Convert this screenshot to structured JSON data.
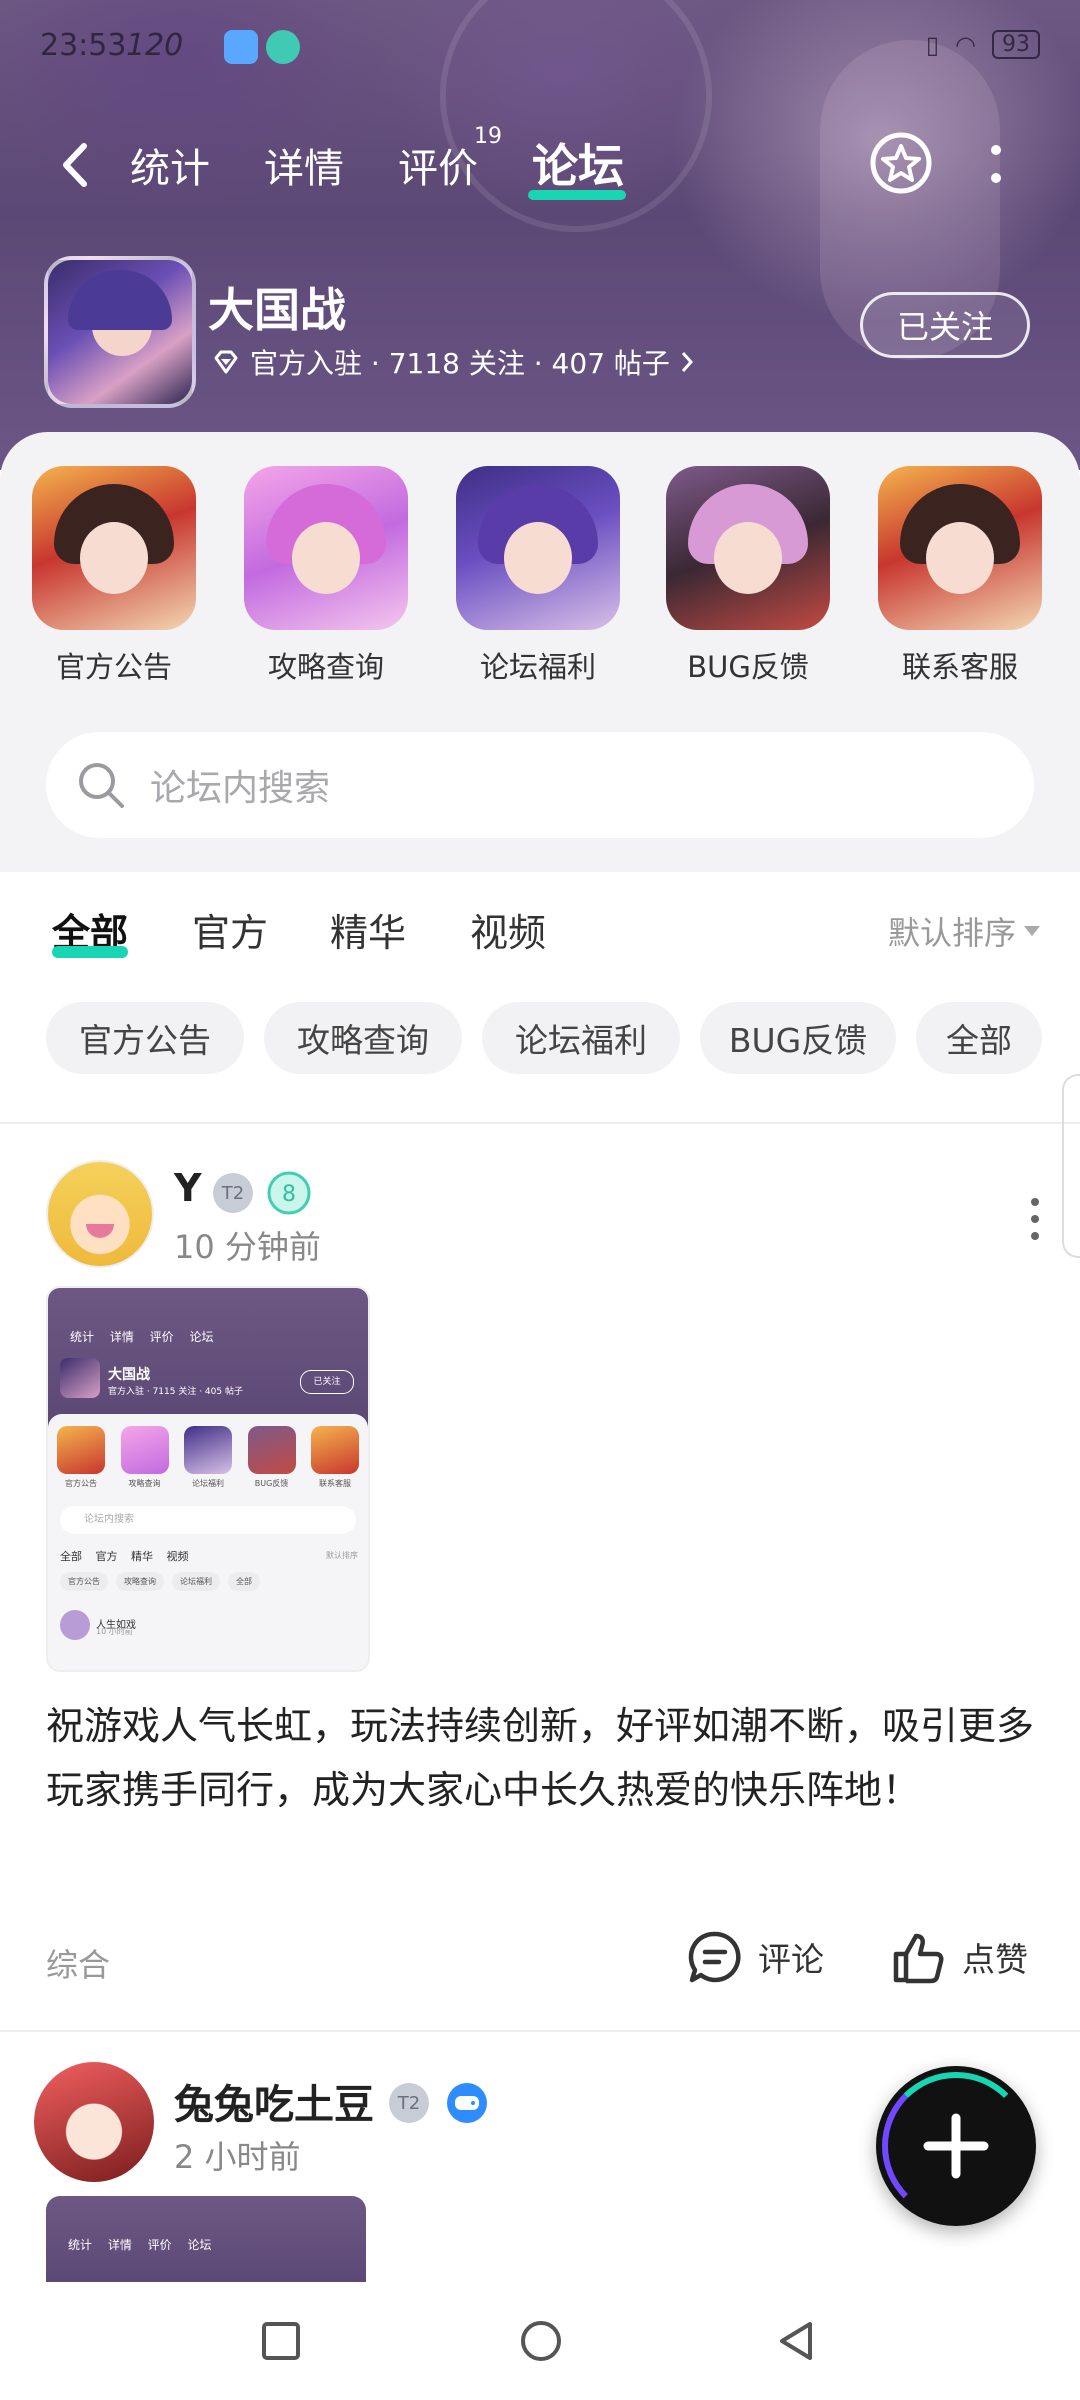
{
  "status_bar": {
    "time": "23:53",
    "network_speed": "120",
    "battery": "93"
  },
  "top_nav": {
    "tabs": [
      {
        "label": "统计"
      },
      {
        "label": "详情"
      },
      {
        "label": "评价",
        "badge": "19"
      },
      {
        "label": "论坛",
        "active": true
      }
    ],
    "icons": [
      "back-icon",
      "star-icon",
      "more-icon"
    ]
  },
  "game": {
    "name": "大国战",
    "meta": "官方入驻 · 7118 关注 · 407 帖子",
    "follow_label": "已关注"
  },
  "categories": [
    {
      "label": "官方公告"
    },
    {
      "label": "攻略查询"
    },
    {
      "label": "论坛福利"
    },
    {
      "label": "BUG反馈"
    },
    {
      "label": "联系客服"
    }
  ],
  "search": {
    "placeholder": "论坛内搜索"
  },
  "filter_tabs": {
    "tabs": [
      "全部",
      "官方",
      "精华",
      "视频"
    ],
    "active": "全部",
    "sort_label": "默认排序"
  },
  "chips": [
    "官方公告",
    "攻略查询",
    "论坛福利",
    "BUG反馈",
    "全部"
  ],
  "posts": [
    {
      "user": "Y",
      "time": "10 分钟前",
      "content": "祝游戏人气长虹，玩法持续创新，好评如潮不断，吸引更多玩家携手同行，成为大家心中长久热爱的快乐阵地！",
      "category": "综合",
      "comment_label": "评论",
      "like_label": "点赞",
      "screenshot": {
        "tabs": "统计 详情 评价 论坛",
        "game_name": "大国战",
        "meta": "官方入驻 · 7115 关注 · 405 帖子",
        "follow": "已关注",
        "cats": [
          "官方公告",
          "攻略查询",
          "论坛福利",
          "BUG反馈",
          "联系客服"
        ],
        "search": "论坛内搜索",
        "tabs2": "全部 官方 精华 视频",
        "sort": "默认排序",
        "chips": [
          "官方公告",
          "攻略查询",
          "论坛福利",
          "全部"
        ],
        "user": "人生如戏",
        "time": "10 小时前"
      }
    },
    {
      "user": "兔兔吃土豆",
      "time": "2 小时前",
      "screenshot_tabs": "统计 详情 评价 论坛"
    }
  ],
  "colors": {
    "accent": "#18d6b3",
    "header_bg": "#5c4875"
  }
}
